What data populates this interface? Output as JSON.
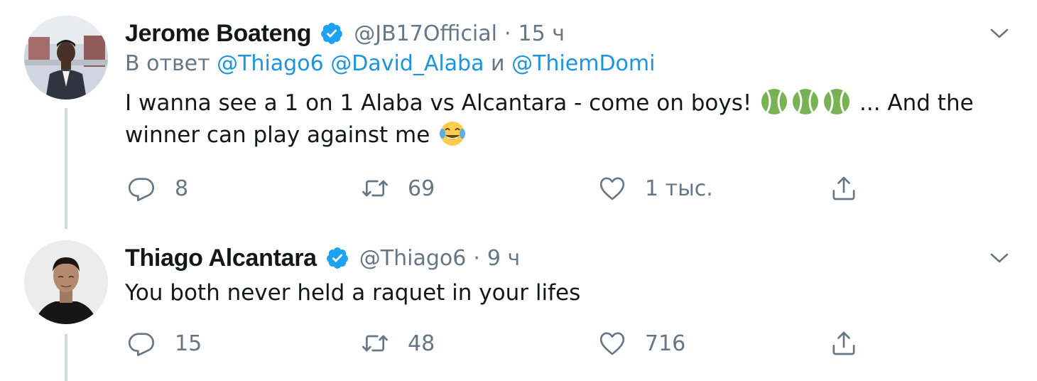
{
  "tweets": [
    {
      "author_name": "Jerome Boateng",
      "handle": "@JB17Official",
      "separator": "·",
      "time": "15 ч",
      "reply_prefix": "В ответ",
      "reply_users": [
        "@Thiago6",
        "@David_Alaba",
        "@ThiemDomi"
      ],
      "reply_joiner": "и",
      "text_part1": "I wanna see a 1 on 1 Alaba vs Alcantara - come on boys!",
      "text_part2": "... And the winner can play against me",
      "emojis": [
        "tennis-ball",
        "tennis-ball",
        "tennis-ball",
        "face-with-tears-of-joy"
      ],
      "reply_count": "8",
      "retweet_count": "69",
      "like_count": "1 тыс.",
      "icons": [
        "verified-badge-icon",
        "chevron-down-icon",
        "reply-icon",
        "retweet-icon",
        "like-icon",
        "share-icon"
      ]
    },
    {
      "author_name": "Thiago Alcantara",
      "handle": "@Thiago6",
      "separator": "·",
      "time": "9 ч",
      "text": "You both never held a raquet in your lifes",
      "reply_count": "15",
      "retweet_count": "48",
      "like_count": "716",
      "icons": [
        "verified-badge-icon",
        "chevron-down-icon",
        "reply-icon",
        "retweet-icon",
        "like-icon",
        "share-icon"
      ]
    }
  ],
  "colors": {
    "link": "#1b95e0",
    "secondary_text": "#657786",
    "primary_text": "#14171a",
    "verified": "#1da1f2",
    "thread_line": "#cfd9de"
  }
}
